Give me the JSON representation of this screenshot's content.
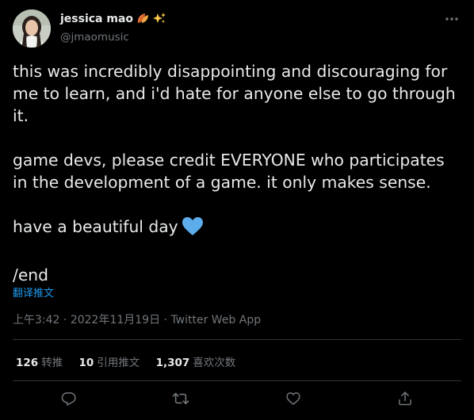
{
  "author": {
    "display_name": "jessica mao",
    "handle": "@jmaomusic",
    "name_emojis": [
      "leaf-icon",
      "sparkles-icon"
    ]
  },
  "tweet": {
    "paragraphs": [
      "this was incredibly disappointing and discouraging for me to learn, and i'd hate for anyone else to go through it.",
      "game devs, please credit EVERYONE who participates in the development of a game. it only makes sense.",
      "have a beautiful day",
      "/end"
    ],
    "translate_label": "翻译推文"
  },
  "meta": {
    "time": "上午3:42",
    "separator": " · ",
    "date": "2022年11月19日",
    "source": "Twitter Web App"
  },
  "stats": {
    "retweets_count": "126",
    "retweets_label": "转推",
    "quotes_count": "10",
    "quotes_label": "引用推文",
    "likes_count": "1,307",
    "likes_label": "喜欢次数"
  },
  "colors": {
    "background": "#000000",
    "text": "#e7e9ea",
    "muted": "#71767b",
    "link": "#1d9bf0",
    "divider": "#2f3336",
    "heart_emoji": "#5dadec"
  },
  "icons": {
    "more": "more-dots-icon",
    "reply": "reply-icon",
    "retweet": "retweet-icon",
    "like": "like-icon",
    "share": "share-icon",
    "heart_emoji": "blue-heart-icon"
  }
}
